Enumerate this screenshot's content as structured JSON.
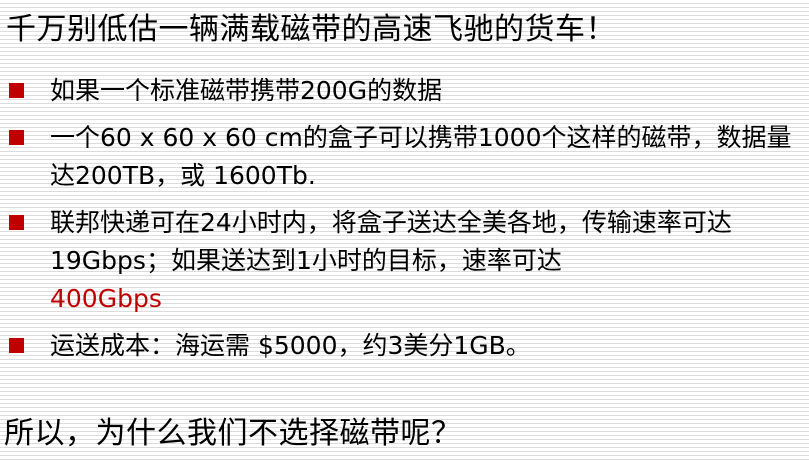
{
  "slide": {
    "title": "千万别低估一辆满载磁带的高速飞驰的货车！",
    "bullets": [
      {
        "text": "如果一个标准磁带携带200G的数据",
        "highlight": ""
      },
      {
        "text": "一个60 x 60 x 60 cm的盒子可以携带1000个这样的磁带，数据量达200TB，或 1600Tb.",
        "highlight": ""
      },
      {
        "text": "联邦快递可在24小时内，将盒子送达全美各地，传输速率可达19Gbps；如果送达到1小时的目标，速率可达",
        "highlight": "400Gbps"
      },
      {
        "text": "运送成本：海运需 $5000，约3美分1GB。",
        "highlight": ""
      }
    ],
    "footer": "所以，为什么我们不选择磁带呢？"
  },
  "colors": {
    "bullet_marker": "#c00000",
    "highlight_text": "#c00000",
    "background": "#ffffff",
    "stripe": "#dcdcdc"
  }
}
